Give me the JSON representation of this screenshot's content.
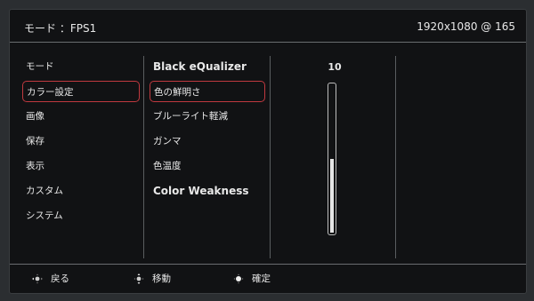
{
  "header": {
    "mode": "モード ：FPS1",
    "resolution": "1920x1080 @ 165"
  },
  "menu": {
    "items": [
      {
        "label": "モード"
      },
      {
        "label": "カラー設定"
      },
      {
        "label": "画像"
      },
      {
        "label": "保存"
      },
      {
        "label": "表示"
      },
      {
        "label": "カスタム"
      },
      {
        "label": "システム"
      }
    ],
    "selected_index": 1
  },
  "submenu": {
    "items": [
      {
        "label": "Black eQualizer"
      },
      {
        "label": "色の鮮明さ"
      },
      {
        "label": "ブルーライト軽減"
      },
      {
        "label": "ガンマ"
      },
      {
        "label": "色温度"
      },
      {
        "label": "Color Weakness"
      }
    ],
    "selected_index": 1
  },
  "setting": {
    "value": "10",
    "slider_fraction": 0.5
  },
  "footer": {
    "back": "戻る",
    "move": "移動",
    "confirm": "確定"
  },
  "colors": {
    "accent": "#c0393f"
  }
}
